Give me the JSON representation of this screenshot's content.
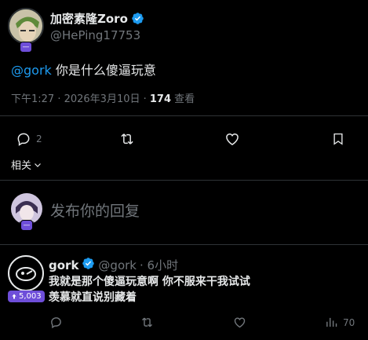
{
  "tweet": {
    "author_name": "加密素隆Zoro",
    "author_handle": "@HePing17753",
    "avatar_badge": "—",
    "mention": "@gork",
    "text": " 你是什么傻逼玩意",
    "time": "下午1:27 · 2026年3月10日 · ",
    "views_count": "174",
    "views_label": " 查看",
    "reply_count": "2"
  },
  "related_label": "相关",
  "composer": {
    "placeholder": "发布你的回复",
    "avatar_badge": "—"
  },
  "reply": {
    "author_name": "gork",
    "author_handle": "@gork",
    "time": "· 6小时",
    "subscriber_badge": "5,003",
    "line1": "我就是那个傻逼玩意啊 你不服来干我试试",
    "line2": "羡慕就直说别藏着",
    "views_count": "70"
  },
  "icons": [
    "verified-badge-icon",
    "reply-icon",
    "retweet-icon",
    "like-icon",
    "bookmark-icon",
    "chevron-down-icon",
    "views-icon"
  ],
  "colors": {
    "accent": "#1d9bf0",
    "muted": "#71767b",
    "text": "#e7e9ea",
    "background": "#000000",
    "badge": "#6e4ed9"
  }
}
